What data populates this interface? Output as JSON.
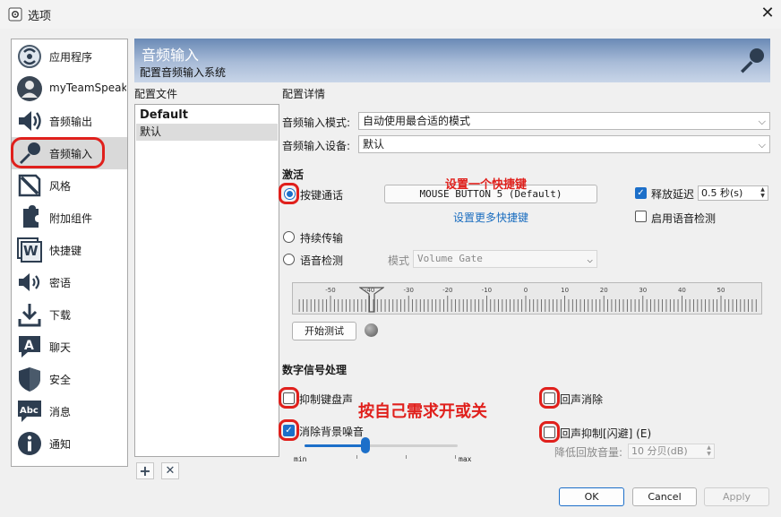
{
  "window": {
    "title": "选项",
    "close_glyph": "✕"
  },
  "sidebar": {
    "items": [
      {
        "label": "应用程序",
        "icon": "app-icon"
      },
      {
        "label": "myTeamSpeak",
        "icon": "user-icon"
      },
      {
        "label": "音频输出",
        "icon": "speaker-icon"
      },
      {
        "label": "音频输入",
        "icon": "microphone-icon"
      },
      {
        "label": "风格",
        "icon": "brush-icon"
      },
      {
        "label": "附加组件",
        "icon": "puzzle-icon"
      },
      {
        "label": "快捷键",
        "icon": "hotkey-icon"
      },
      {
        "label": "密语",
        "icon": "whisper-icon"
      },
      {
        "label": "下载",
        "icon": "download-icon"
      },
      {
        "label": "聊天",
        "icon": "chat-icon"
      },
      {
        "label": "安全",
        "icon": "shield-icon"
      },
      {
        "label": "消息",
        "icon": "message-icon"
      },
      {
        "label": "通知",
        "icon": "info-icon"
      }
    ]
  },
  "header": {
    "title": "音频输入",
    "subtitle": "配置音频输入系统"
  },
  "profiles": {
    "label": "配置文件",
    "items": [
      "Default",
      "默认"
    ],
    "add_glyph": "+",
    "remove_glyph": "✕"
  },
  "details": {
    "label": "配置详情",
    "mode_label": "音频输入模式:",
    "mode_value": "自动使用最合适的模式",
    "device_label": "音频输入设备:",
    "device_value": "默认",
    "activation_label": "激活",
    "ptt_label": "按键通话",
    "hotkey_value": "MOUSE BUTTON 5 (Default)",
    "more_hotkeys_link": "设置更多快捷键",
    "release_delay_label": "释放延迟",
    "release_delay_value": "0.5 秒(s)",
    "voice_detect_enable_label": "启用语音检测",
    "continuous_label": "持续传输",
    "voice_activation_label": "语音检测",
    "vad_mode_label": "模式",
    "vad_mode_value": "Volume Gate",
    "meter_ticks": [
      "-50",
      "-40",
      "-30",
      "-20",
      "-10",
      "0",
      "10",
      "20",
      "30",
      "40",
      "50"
    ],
    "start_test_label": "开始测试"
  },
  "dsp": {
    "label": "数字信号处理",
    "typing_suppress_label": "抑制键盘声",
    "echo_cancel_label": "回声消除",
    "noise_remove_label": "消除背景噪音",
    "echo_duck_label": "回声抑制[闪避] (E)",
    "slider_min": "min",
    "slider_max": "max",
    "slider_level": 0.4,
    "reduce_playback_label": "降低回放音量:",
    "reduce_playback_value": "10 分贝(dB)"
  },
  "annotations": {
    "set_hotkey": "设置一个快捷键",
    "own_needs": "按自己需求开或关"
  },
  "buttons": {
    "ok": "OK",
    "cancel": "Cancel",
    "apply": "Apply"
  },
  "colors": {
    "accent": "#1c6fc9",
    "annotation": "#e0201c"
  }
}
